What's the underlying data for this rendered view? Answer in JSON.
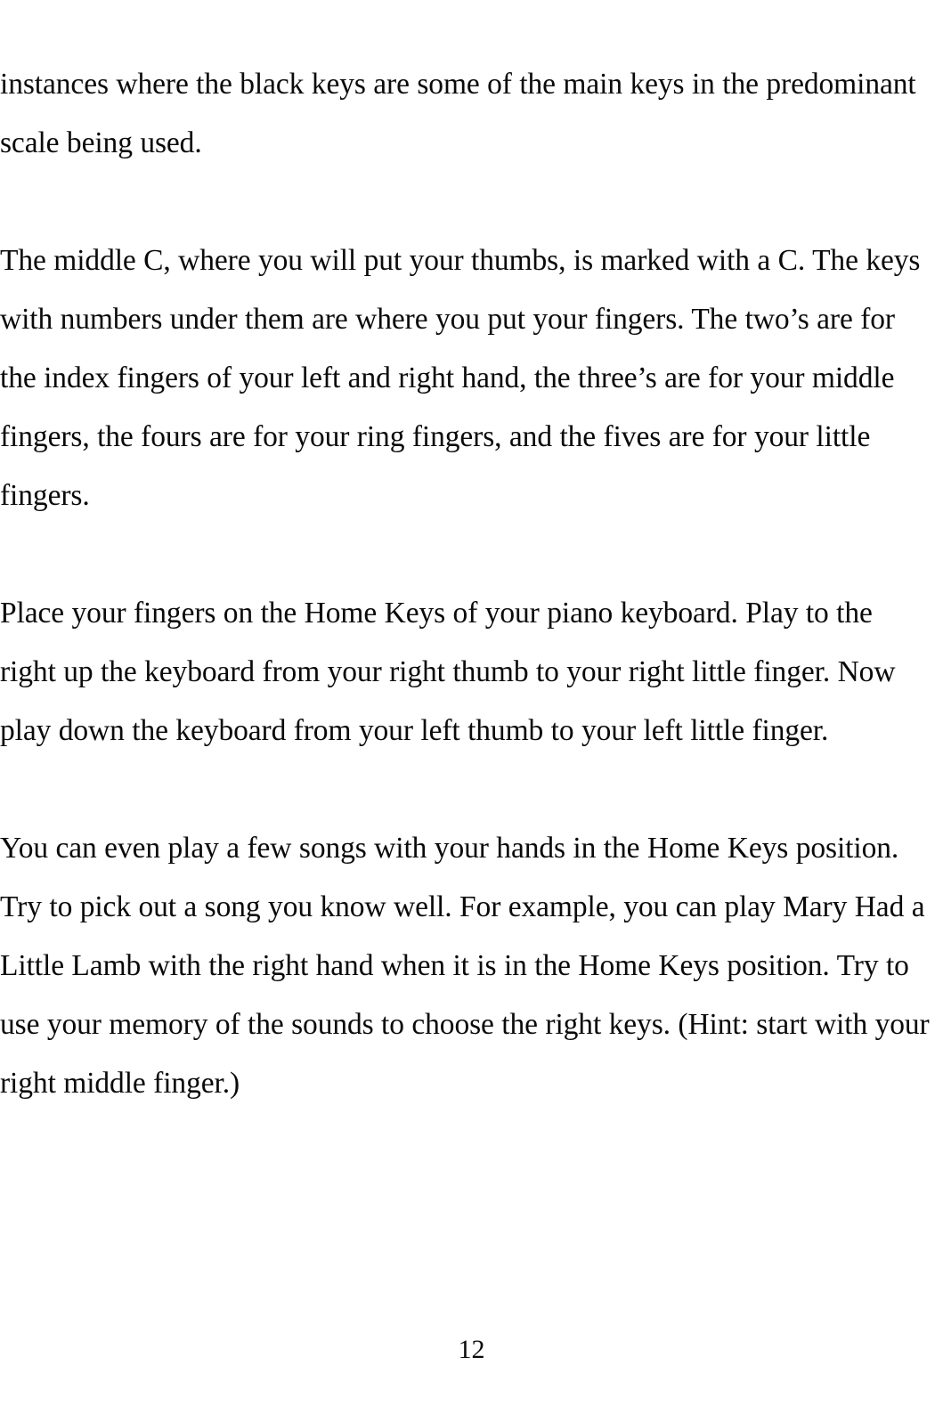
{
  "document": {
    "page_number": "12",
    "paragraphs": [
      "instances where the black keys are some of the main keys in the predominant scale being used.",
      "The middle C, where you will put your thumbs, is marked with a C. The keys with numbers under them are where you put your fingers. The two’s are for the index fingers of your left and right hand, the three’s are for your middle fingers, the fours are for your ring fingers, and the fives are for your little fingers.",
      "Place your fingers on the Home Keys of your piano keyboard. Play to the right up the keyboard from your right thumb to your right little finger. Now play down the keyboard from your left thumb to your left little finger.",
      "You can even play a few songs with your hands in the Home Keys position. Try to pick out a song you know well. For example, you can play Mary Had a Little Lamb with the right hand when it is in the Home Keys position. Try to use your memory of the sounds to choose the right keys. (Hint: start with your right middle finger.)"
    ]
  }
}
